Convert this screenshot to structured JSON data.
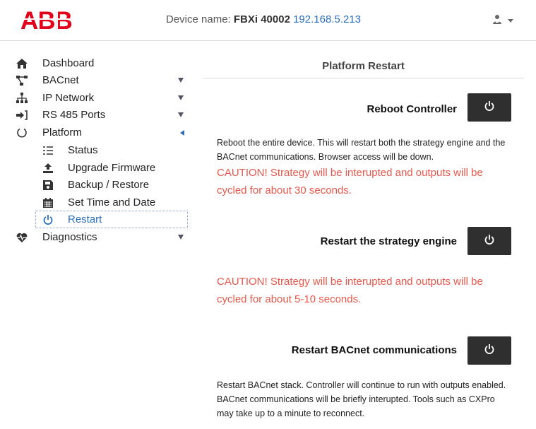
{
  "header": {
    "logo_text": "ABB",
    "device_prefix": "Device name: ",
    "device_name": "FBXi 40002",
    "device_ip": "192.168.5.213",
    "user_icon": "user-icon"
  },
  "sidebar": {
    "items": [
      {
        "label": "Dashboard",
        "icon": "home-icon"
      },
      {
        "label": "BACnet",
        "icon": "network-tree-icon"
      },
      {
        "label": "IP Network",
        "icon": "sitemap-icon"
      },
      {
        "label": "RS 485 Ports",
        "icon": "sign-in-icon"
      },
      {
        "label": "Platform",
        "icon": "circle-notch-icon"
      },
      {
        "label": "Diagnostics",
        "icon": "heartbeat-icon"
      }
    ],
    "subitems": [
      {
        "label": "Status",
        "icon": "list-icon"
      },
      {
        "label": "Upgrade Firmware",
        "icon": "upload-icon"
      },
      {
        "label": "Backup / Restore",
        "icon": "floppy-icon"
      },
      {
        "label": "Set Time and Date",
        "icon": "calendar-icon"
      },
      {
        "label": "Restart",
        "icon": "power-icon"
      }
    ]
  },
  "main": {
    "title": "Platform Restart",
    "reboot": {
      "label": "Reboot Controller",
      "desc": "Reboot the entire device. This will restart both the strategy engine and the BACnet communications. Browser access will be down.",
      "caution": "CAUTION! Strategy will be interupted and outputs will be cycled for about 30 seconds."
    },
    "strategy": {
      "label": "Restart the strategy engine",
      "caution": "CAUTION! Strategy will be interupted and outputs will be cycled for about 5-10 seconds."
    },
    "bacnet": {
      "label": "Restart BACnet communications",
      "desc": "Restart BACnet stack. Controller will continue to run with outputs enabled. BACnet communications will be briefly interupted. Tools such as CXPro may take up to a minute to reconnect."
    }
  },
  "colors": {
    "accent": "#2a6ebb",
    "caution": "#e8584a",
    "logo": "#e2001a",
    "button": "#2f2f2f"
  }
}
